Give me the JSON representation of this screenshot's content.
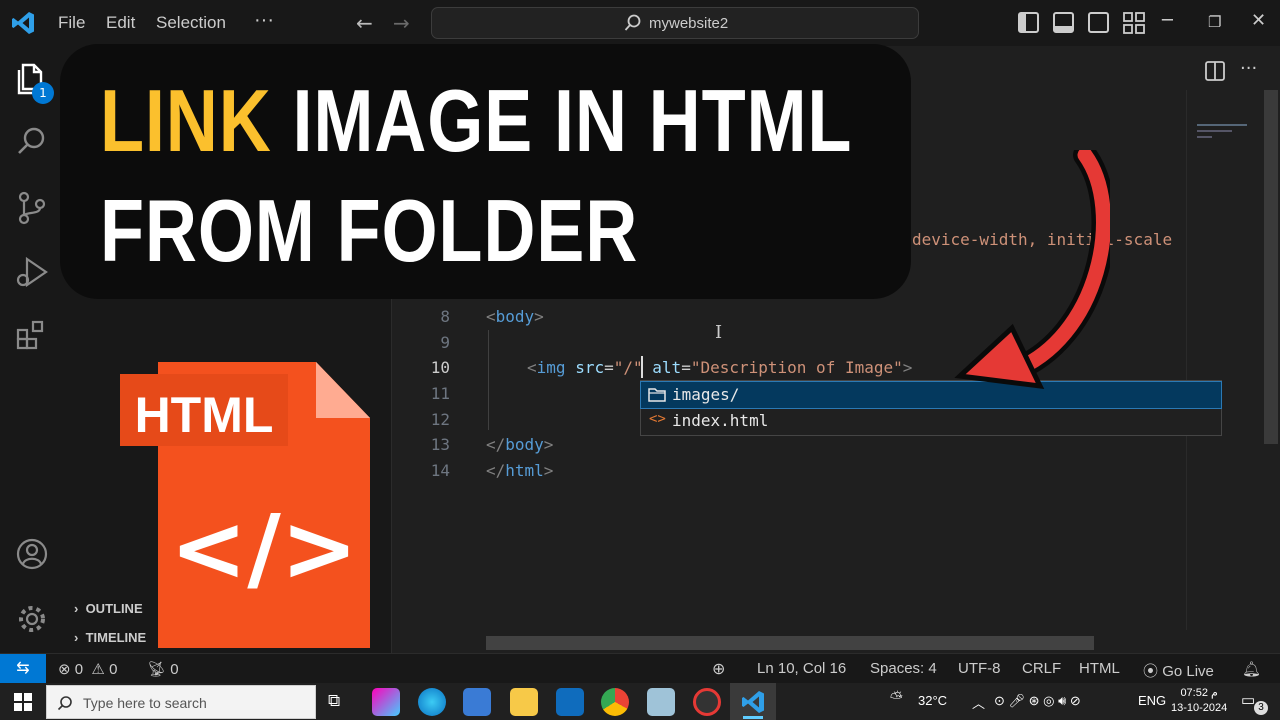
{
  "titlebar": {
    "menu": [
      "File",
      "Edit",
      "Selection",
      "···"
    ],
    "search_text": "mywebsite2"
  },
  "activity": {
    "explorer_badge": "1"
  },
  "sidebar": {
    "sections": [
      "OUTLINE",
      "TIMELINE"
    ]
  },
  "editor": {
    "lines": [
      {
        "num": "8",
        "active": false
      },
      {
        "num": "9",
        "active": false
      },
      {
        "num": "10",
        "active": true
      },
      {
        "num": "11",
        "active": false
      },
      {
        "num": "12",
        "active": false
      },
      {
        "num": "13",
        "active": false
      },
      {
        "num": "14",
        "active": false
      }
    ],
    "partial_meta_text": "device-width, initial-scale",
    "body_open": "body",
    "img_tag": "img",
    "src_attr": "src",
    "src_value": "\"/\"",
    "alt_attr": "alt",
    "alt_value": "\"Description of Image\"",
    "body_close": "body",
    "html_close": "html"
  },
  "suggestions": [
    {
      "label": "images/",
      "icon": "folder-icon",
      "selected": true
    },
    {
      "label": "index.html",
      "icon": "code-icon",
      "selected": false
    }
  ],
  "overlay": {
    "title_highlight": "LINK",
    "title_rest": " IMAGE IN HTML",
    "title_line2": "FROM FOLDER",
    "file_label": "HTML",
    "file_code": "</>"
  },
  "statusbar": {
    "errors": "0",
    "warnings": "0",
    "ports": "0",
    "position": "Ln 10, Col 16",
    "spaces": "Spaces: 4",
    "encoding": "UTF-8",
    "eol": "CRLF",
    "language": "HTML",
    "golive": "Go Live"
  },
  "taskbar": {
    "search_placeholder": "Type here to search",
    "weather": "32°C",
    "lang": "ENG",
    "time": "07:52 م",
    "date": "13-10-2024",
    "notifications": "3"
  },
  "colors": {
    "accent": "#0078d4",
    "highlight": "#fbc02d",
    "html_orange": "#f4511e",
    "arrow_red": "#e53935"
  }
}
